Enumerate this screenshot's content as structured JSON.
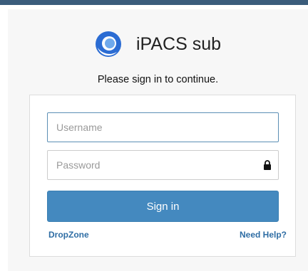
{
  "header": {
    "title": "iPACS sub",
    "logo_icon": "ipacs-logo-icon"
  },
  "subtitle": "Please sign in to continue.",
  "login": {
    "username_placeholder": "Username",
    "password_placeholder": "Password",
    "lock_icon": "lock-icon",
    "signin_label": "Sign in"
  },
  "links": {
    "dropzone": "DropZone",
    "help": "Need Help?"
  },
  "colors": {
    "topbar": "#3b5c7b",
    "primary_button": "#4489bf",
    "link": "#2e6da4",
    "logo_dark": "#2b6cd3",
    "logo_light": "#6fa9ec"
  }
}
